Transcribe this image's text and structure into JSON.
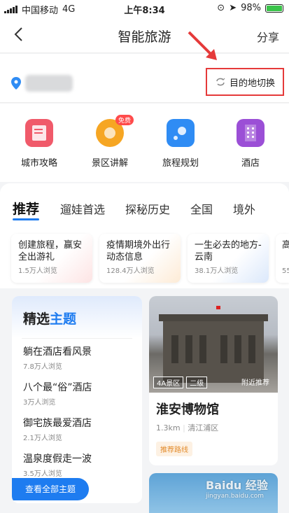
{
  "status": {
    "carrier": "中国移动",
    "network": "4G",
    "time": "上午8:34",
    "battery": "98%",
    "battery_level": 0.98
  },
  "nav": {
    "title": "智能旅游",
    "share": "分享"
  },
  "location": {
    "switch_label": "目的地切换"
  },
  "quick": [
    {
      "label": "城市攻略",
      "icon": "guide-book-icon",
      "color": "#f05a6a"
    },
    {
      "label": "景区讲解",
      "icon": "audio-guide-icon",
      "color": "#f6a623",
      "badge": "免费"
    },
    {
      "label": "旅程规划",
      "icon": "route-plan-icon",
      "color": "#2f8cf4"
    },
    {
      "label": "酒店",
      "icon": "hotel-icon",
      "color": "#9b4fd6"
    }
  ],
  "tabs": [
    "推荐",
    "遛娃首选",
    "探秘历史",
    "全国",
    "境外"
  ],
  "rec_cards": [
    {
      "title": "创建旅程，赢安全出游礼",
      "views": "1.5万人浏览"
    },
    {
      "title": "疫情期境外出行动态信息",
      "views": "128.4万人浏览"
    },
    {
      "title": "一生必去的地方-云南",
      "views": "38.1万人浏览"
    },
    {
      "title": "高",
      "views": "55"
    }
  ],
  "theme": {
    "title_a": "精选",
    "title_b": "主题",
    "items": [
      {
        "title": "躺在酒店看风景",
        "views": "7.8万人浏览"
      },
      {
        "title": "八个最“俗”酒店",
        "views": "3万人浏览"
      },
      {
        "title": "御宅族最爱酒店",
        "views": "2.1万人浏览"
      },
      {
        "title": "温泉度假走一波",
        "views": "3.5万人浏览"
      }
    ],
    "all_button": "查看全部主题"
  },
  "poi": {
    "badge_level": "4A景区",
    "badge_grade": "二级",
    "nearby": "附近推荐",
    "name": "淮安博物馆",
    "distance": "1.3km",
    "district": "清江浦区",
    "tag": "推荐路线"
  },
  "watermark": {
    "brand": "Baidu 经验",
    "url": "jingyan.baidu.com"
  }
}
